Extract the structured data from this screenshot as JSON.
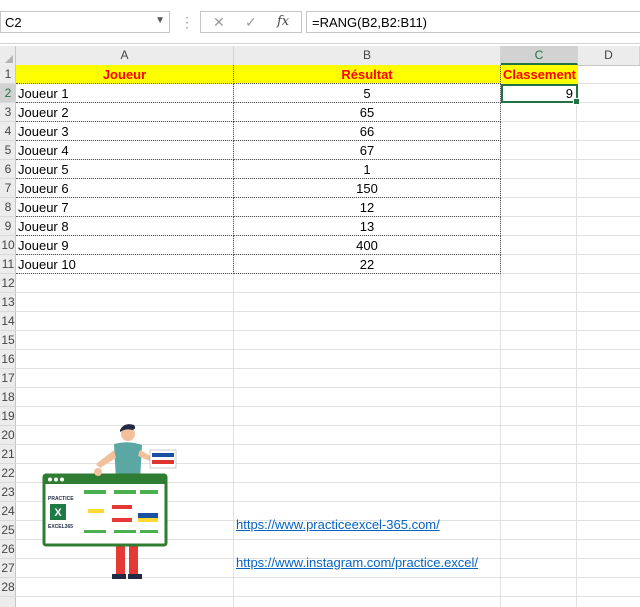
{
  "formula_bar": {
    "name_box": "C2",
    "name_box_arrow": "▼",
    "separator": "⋮",
    "cancel_icon": "✕",
    "enter_icon": "✓",
    "fx_label": "fx",
    "formula": "=RANG(B2,B2:B11)"
  },
  "columns": [
    "A",
    "B",
    "C",
    "D"
  ],
  "selected_column": "C",
  "rows": [
    "1",
    "2",
    "3",
    "4",
    "5",
    "6",
    "7",
    "8",
    "9",
    "10",
    "11",
    "12",
    "13",
    "14",
    "15",
    "16",
    "17",
    "18",
    "19",
    "20",
    "21",
    "22",
    "23",
    "24",
    "25",
    "26",
    "27",
    "28"
  ],
  "selected_row": "2",
  "table": {
    "headers": {
      "player": "Joueur",
      "result": "Résultat",
      "rank": "Classement"
    },
    "players": [
      "Joueur 1",
      "Joueur 2",
      "Joueur 3",
      "Joueur 4",
      "Joueur 5",
      "Joueur 6",
      "Joueur 7",
      "Joueur 8",
      "Joueur 9",
      "Joueur 10"
    ],
    "results": [
      "5",
      "65",
      "66",
      "67",
      "1",
      "150",
      "12",
      "13",
      "400",
      "22"
    ],
    "rank_c2": "9"
  },
  "links": {
    "website": "https://www.practiceexcel-365.com/",
    "instagram": "https://www.instagram.com/practice.excel/"
  },
  "logo": {
    "text_top": "PRACTICE",
    "text_bottom": "EXCEL365",
    "letter": "X"
  },
  "colors": {
    "header_fill": "#ffff00",
    "header_text": "#ff0000",
    "accent": "#217346",
    "link": "#0563c1"
  }
}
